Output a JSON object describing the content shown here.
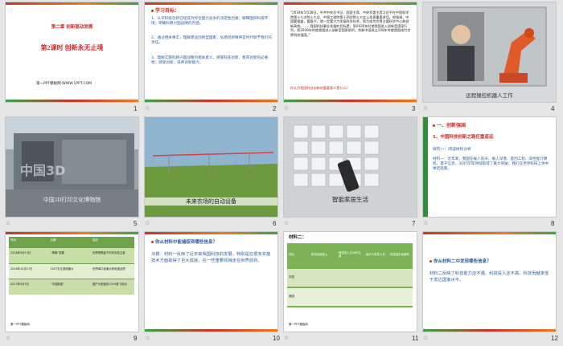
{
  "slides": [
    {
      "num": "1",
      "star": "",
      "title1": "第二章 创新驱动发展",
      "title2": "第2课时 创新永无止境",
      "footer": "第一PPT模板网-WWW.1PPT.COM"
    },
    {
      "num": "2",
      "star": "☆",
      "heading": "学习目标：",
      "items": [
        "1、认识科技创新已经成为综合国力竞争的决定性因素；解释国际科技环境；明确科教兴国战略的内涵。",
        "2、通过相关事实，理解建设创新型国家，弘扬创新精神是时代赋予我们的责任。",
        "3、理解实施科教兴国战略的相关意义，感受科技创新、教育创新的必要性；感受创新、培养创新能力。"
      ]
    },
    {
      "num": "3",
      "star": "☆",
      "para": "“2018年5月28日，中共中央总书记、国家主席、中央军委主席习近平在中国科学院第十九次院士大会、中国工程院第十四次院士大会上发表重要讲话。他强调，中国要强盛，要复兴，就一定要大力发展科学技术，努力成为世界主要科学中心和创新高地。……我国科技事业发展的目标是，到2020年时使我国进入创新型国家行列，到2030年时使我国进入创新型国家前列，到新中国成立100年时使我国成为世界科技强国。”",
      "question": "你认为我国科技创新的重要意义是什么？"
    },
    {
      "num": "4",
      "star": "☆",
      "caption": "远程操控机器人工作"
    },
    {
      "num": "5",
      "star": "☆",
      "caption": "中国3D打印文化博物馆"
    },
    {
      "num": "6",
      "star": "☆",
      "caption": "未来农场的自动设备"
    },
    {
      "num": "7",
      "star": "☆",
      "caption": "智能家居生活"
    },
    {
      "num": "8",
      "star": "☆",
      "heading1": "一、创新强国",
      "heading2": "1、中国科技创新之路任重道远",
      "item1": "探究一：阅读材料分析",
      "item2": "材料一：近年来，我国在载人航天、载人深潜、基因工程、高性能计算机、量子信息、3D打印等领域取得了重大突破，我们在世界科技上体中举足轻重。"
    },
    {
      "num": "9",
      "star": "☆",
      "headers": [
        "时间",
        "标题",
        "描述"
      ],
      "rows": [
        [
          "2016年9月15日",
          "“嫦娥”重要",
          "世界首颗量子科学实验卫星"
        ],
        [
          "2016年10月17日",
          "FAST天文观测最大",
          "世界单口径最大射电望远镜"
        ],
        [
          "2017年5月5日",
          "“中国制造”",
          "国产大型客机C919首飞成功"
        ]
      ],
      "footer": "第一PPT模板网"
    },
    {
      "num": "10",
      "star": "☆",
      "q": "你从材料中能捕捉到哪些信息？",
      "a": "点拨：材料一反映了近年来我国科技的发展，特别是在很多实施技术方面取得了巨大成就，在一些重要领域走在世界前列。"
    },
    {
      "num": "11",
      "star": "☆",
      "title": "材料二：",
      "headers": [
        "项目",
        "研发经费投入",
        "研发投入占GDP比重",
        "每万人研发人员",
        "科技进步贡献率"
      ],
      "rows": [
        [
          "中国",
          "",
          "",
          "",
          ""
        ],
        [
          "美国",
          "",
          "",
          "",
          ""
        ]
      ],
      "footer": "第一PPT模板网"
    },
    {
      "num": "12",
      "star": "☆",
      "q": "你从材料二中发现哪些信息？",
      "a": "材料二反映了科技能力还不强、科技投入还不高、科技贡献率低于发达国家水平。"
    }
  ]
}
